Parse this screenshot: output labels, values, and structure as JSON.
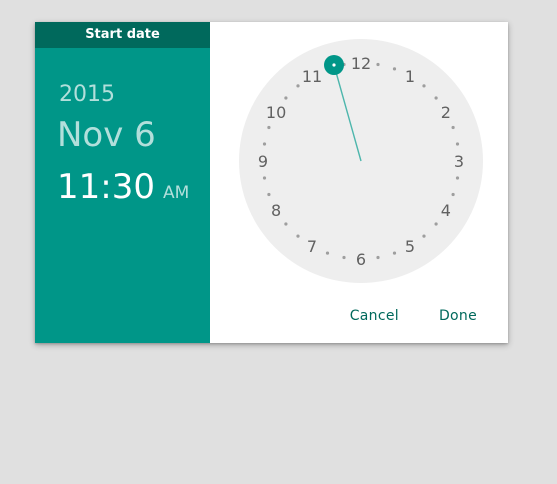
{
  "header": {
    "title": "Start date"
  },
  "summary": {
    "year": "2015",
    "date": "Nov 6",
    "hour": "11",
    "colon": ":",
    "minute": "30",
    "ampm": "AM"
  },
  "clock": {
    "mode": "minutes",
    "selected_minute": 0,
    "numbers": [
      "12",
      "1",
      "2",
      "3",
      "4",
      "5",
      "6",
      "7",
      "8",
      "9",
      "10",
      "11"
    ]
  },
  "actions": {
    "cancel_label": "Cancel",
    "done_label": "Done"
  },
  "colors": {
    "accent": "#009688",
    "accent_dark": "#00695c",
    "header_text": "#ffffff",
    "clock_face": "#eeeeee"
  }
}
